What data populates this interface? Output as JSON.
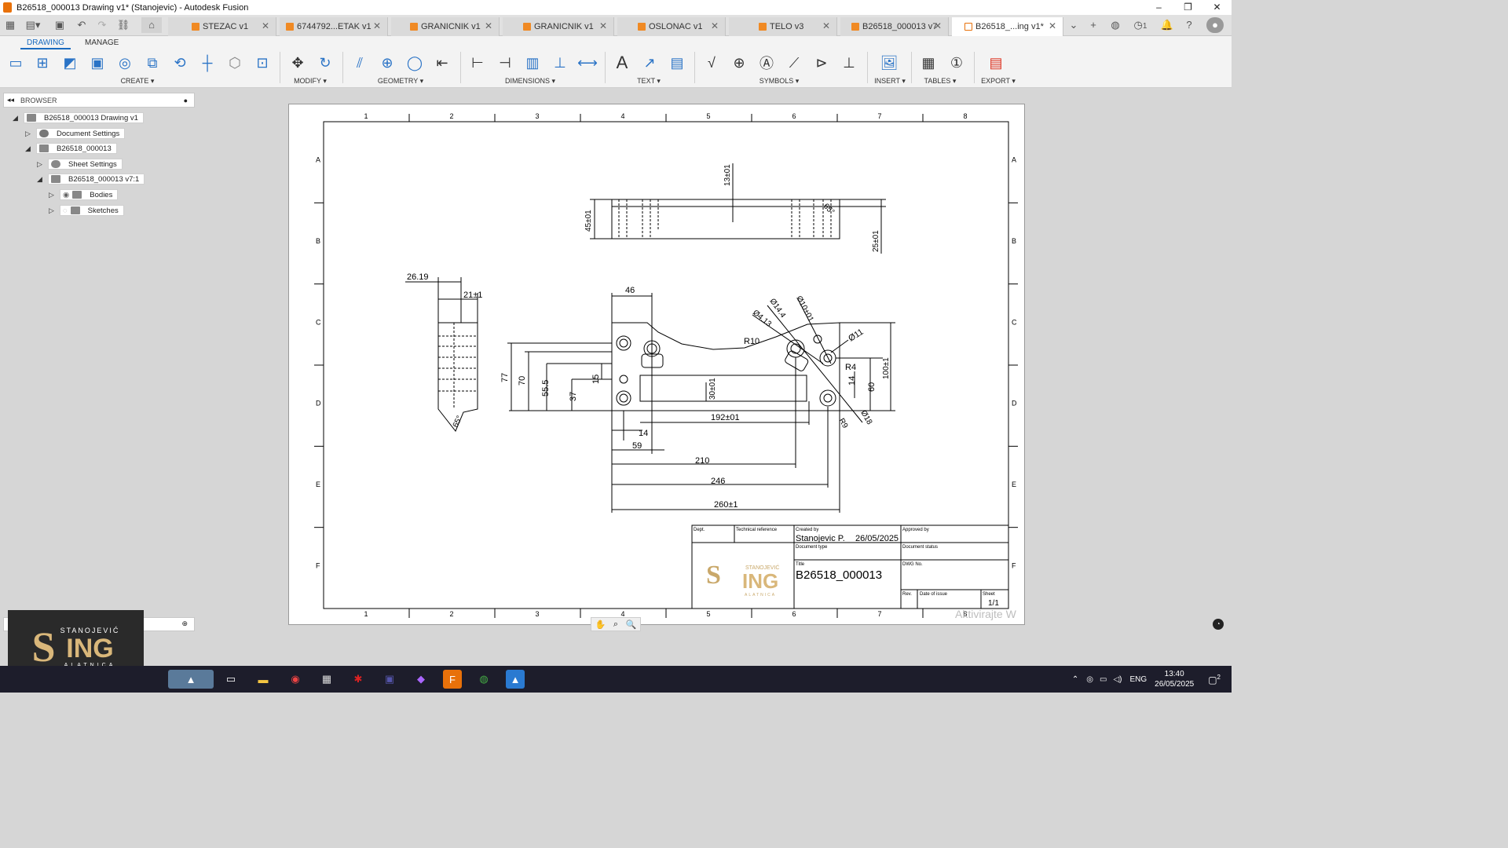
{
  "window": {
    "title": "B26518_000013 Drawing v1* (Stanojevic) - Autodesk Fusion",
    "controls": [
      "–",
      "❐",
      "✕"
    ]
  },
  "tabs": [
    {
      "label": "STEZAC v1",
      "active": false
    },
    {
      "label": "6744792...ETAK v1",
      "active": false
    },
    {
      "label": "GRANICNIK v1",
      "active": false
    },
    {
      "label": "GRANICNIK v1",
      "active": false
    },
    {
      "label": "OSLONAC v1",
      "active": false
    },
    {
      "label": "TELO v3",
      "active": false
    },
    {
      "label": "B26518_000013 v7",
      "active": false
    },
    {
      "label": "B26518_...ing v1*",
      "active": true
    }
  ],
  "tabbar_right": {
    "badge_count": "1"
  },
  "ribbon": {
    "tabs": [
      "DRAWING",
      "MANAGE"
    ],
    "groups": [
      "CREATE",
      "MODIFY",
      "GEOMETRY",
      "DIMENSIONS",
      "TEXT",
      "SYMBOLS",
      "INSERT",
      "TABLES",
      "EXPORT"
    ]
  },
  "browser": {
    "title": "BROWSER",
    "nodes": [
      "B26518_000013 Drawing v1",
      "Document Settings",
      "B26518_000013",
      "Sheet Settings",
      "B26518_000013 v7:1",
      "Bodies",
      "Sketches"
    ]
  },
  "drawing": {
    "columns": [
      "1",
      "2",
      "3",
      "4",
      "5",
      "6",
      "7",
      "8"
    ],
    "rows": [
      "A",
      "B",
      "C",
      "D",
      "E",
      "F"
    ],
    "dims": {
      "d13": "13±01",
      "d45": "45±01",
      "d25": "25±01",
      "a65top": "65°",
      "d2619": "26.19",
      "d21": "21±1",
      "a65side": "65°",
      "d46": "46",
      "d144": "Ø14.4",
      "d413": "Ø4.13",
      "d10": "Ø10±01",
      "r10": "R10",
      "d11": "Ø11",
      "r4": "R4",
      "d100": "100±1",
      "d60": "60",
      "d14v": "14",
      "d77": "77",
      "d70": "70",
      "d555": "55.5",
      "d37": "37",
      "d15": "15",
      "d30": "30±01",
      "d192": "192±01",
      "d14": "14",
      "d59": "59",
      "d210": "210",
      "d246": "246",
      "d260": "260±1",
      "r9": "R9",
      "d18": "Ø18"
    },
    "titleblock": {
      "dept_label": "Dept.",
      "techref_label": "Technical reference",
      "created_label": "Created by",
      "created_value": "Stanojevic P.",
      "date_value": "26/05/2025",
      "approved_label": "Approved by",
      "doctype_label": "Document type",
      "docstatus_label": "Document status",
      "title_label": "Title",
      "title_value": "B26518_000013",
      "dwg_label": "DWG No.",
      "rev_label": "Rev.",
      "issue_label": "Date of issue",
      "sheet_label": "Sheet",
      "sheet_value": "1/1",
      "logo_top": "STANOJEVIĆ",
      "logo_big": "ING",
      "logo_sub": "ALATNICA"
    }
  },
  "watermark": "Aktivirajte W",
  "overlay_logo": {
    "top": "STANOJEVIĆ",
    "big": "ING",
    "sub": "ALATNICA"
  },
  "taskbar": {
    "lang": "ENG",
    "time": "13:40",
    "date": "26/05/2025",
    "notifications": "2"
  }
}
